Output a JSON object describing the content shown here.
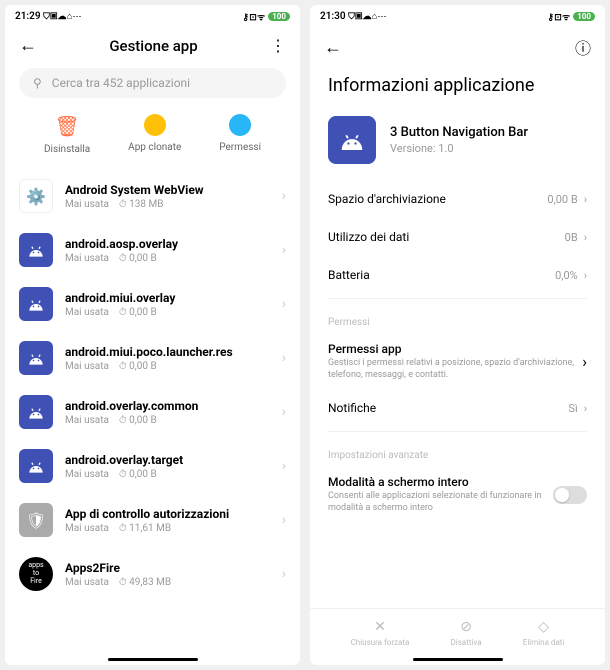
{
  "left": {
    "time": "21:29",
    "status_icons_left": "⛉ ▣ ☁ ⌂ ⋯",
    "status_icons_right": "⚷ ⊡ ᯤ",
    "battery": "100",
    "title": "Gestione app",
    "search_placeholder": "Cerca tra 452 applicazioni",
    "actions": {
      "uninstall": "Disinstalla",
      "clone": "App clonate",
      "perms": "Permessi"
    },
    "apps": [
      {
        "name": "Android System WebView",
        "usage": "Mai usata",
        "size": "138 MB",
        "icon": "gear"
      },
      {
        "name": "android.aosp.overlay",
        "usage": "Mai usata",
        "size": "0,00 B",
        "icon": "android"
      },
      {
        "name": "android.miui.overlay",
        "usage": "Mai usata",
        "size": "0,00 B",
        "icon": "android"
      },
      {
        "name": "android.miui.poco.launcher.res",
        "usage": "Mai usata",
        "size": "0,00 B",
        "icon": "android"
      },
      {
        "name": "android.overlay.common",
        "usage": "Mai usata",
        "size": "0,00 B",
        "icon": "android"
      },
      {
        "name": "android.overlay.target",
        "usage": "Mai usata",
        "size": "0,00 B",
        "icon": "android"
      },
      {
        "name": "App di controllo autorizzazioni",
        "usage": "Mai usata",
        "size": "11,61 MB",
        "icon": "shield"
      },
      {
        "name": "Apps2Fire",
        "usage": "Mai usata",
        "size": "49,83 MB",
        "icon": "a2f"
      }
    ]
  },
  "right": {
    "time": "21:30",
    "status_icons_left": "⛉ ▣ ☁ ⌂ ⋯",
    "status_icons_right": "⚷ ⊡ ᯤ",
    "battery": "100",
    "title": "Informazioni applicazione",
    "app_name": "3 Button Navigation Bar",
    "version_label": "Versione: 1.0",
    "storage_label": "Spazio d'archiviazione",
    "storage_val": "0,00 B",
    "data_label": "Utilizzo dei dati",
    "data_val": "0B",
    "battery_label": "Batteria",
    "battery_val": "0,0%",
    "perms_section": "Permessi",
    "perms_title": "Permessi app",
    "perms_desc": "Gestisci i permessi relativi a posizione, spazio d'archiviazione, telefono, messaggi, e contatti.",
    "notif_label": "Notifiche",
    "notif_val": "Sì",
    "adv_section": "Impostazioni avanzate",
    "fullscreen_title": "Modalità a schermo intero",
    "fullscreen_desc": "Consenti alle applicazioni selezionate di funzionare in modalità a schermo intero",
    "force_stop": "Chiusura forzata",
    "disable": "Disattiva",
    "clear": "Elimina dati"
  }
}
